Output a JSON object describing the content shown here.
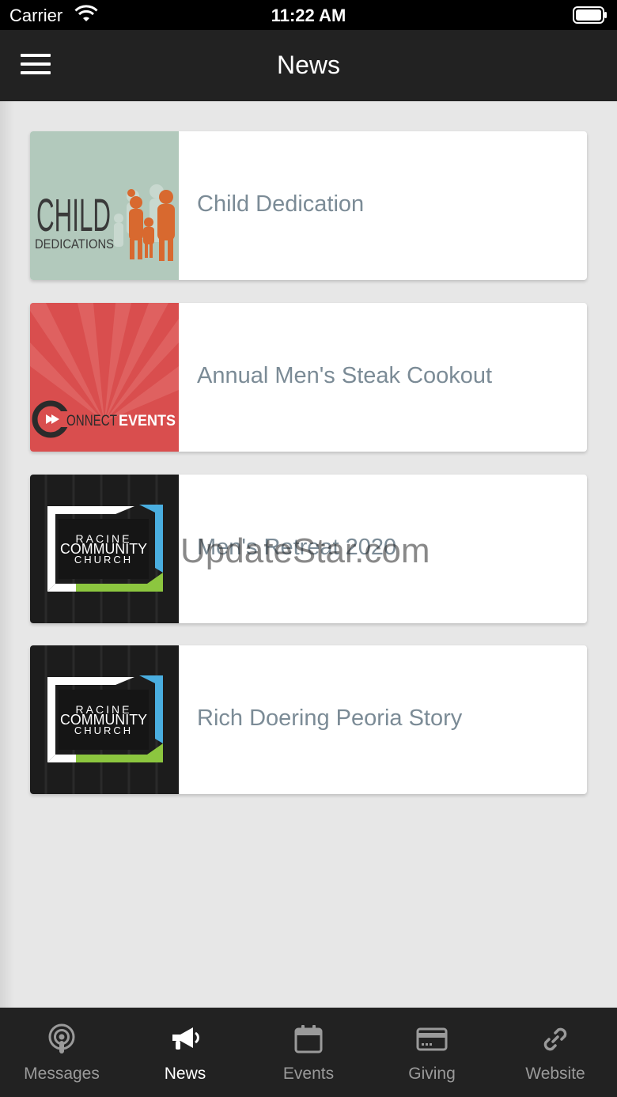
{
  "status_bar": {
    "carrier": "Carrier",
    "time": "11:22 AM"
  },
  "nav": {
    "title": "News"
  },
  "news_items": [
    {
      "label": "Child Dedication",
      "thumb_text_1": "CHILD",
      "thumb_text_2": "DEDICATIONS"
    },
    {
      "label": "Annual Men's Steak Cookout",
      "thumb_text_1": "ONNECT",
      "thumb_text_2": "EVENTS"
    },
    {
      "label": "Men's Retreat 2020",
      "thumb_text_1": "RACINE",
      "thumb_text_2": "COMMUNITY",
      "thumb_text_3": "CHURCH"
    },
    {
      "label": "Rich Doering Peoria Story",
      "thumb_text_1": "RACINE",
      "thumb_text_2": "COMMUNITY",
      "thumb_text_3": "CHURCH"
    }
  ],
  "watermark": "UpdateStar.com",
  "tabs": [
    {
      "label": "Messages",
      "icon": "podcast-icon",
      "active": false
    },
    {
      "label": "News",
      "icon": "megaphone-icon",
      "active": true
    },
    {
      "label": "Events",
      "icon": "calendar-icon",
      "active": false
    },
    {
      "label": "Giving",
      "icon": "credit-card-icon",
      "active": false
    },
    {
      "label": "Website",
      "icon": "link-icon",
      "active": false
    }
  ],
  "colors": {
    "nav_bg": "#222222",
    "content_bg": "#e7e7e7",
    "label_text": "#7b8b96",
    "tab_inactive": "#9a9a9a",
    "tab_active": "#ffffff"
  }
}
